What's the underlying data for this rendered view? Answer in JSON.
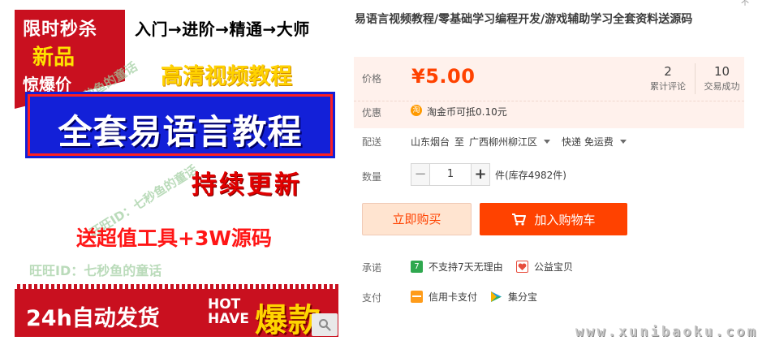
{
  "image": {
    "corner": [
      "限时秒杀",
      "新品",
      "惊爆价"
    ],
    "path": "入门→进阶→精通→大师",
    "hd": "高清视频教程",
    "headline": "全套易语言教程",
    "update": "持续更新",
    "gift": "送超值工具+3W源码",
    "watermark_rot": "旺旺ID：七秒鱼的童话",
    "watermark_small": "旺旺ID：七秒鱼的童话",
    "watermark_bottom": "旺旺ID：七秒鱼的童话",
    "bottom_text": "24h自动发货",
    "hot": "HOT",
    "have": "HAVE",
    "baokuan": "爆款"
  },
  "product": {
    "title": "易语言视频教程/零基础学习编程开发/游戏辅助学习全套资料送源码",
    "price_label": "价格",
    "price": "¥5.00",
    "reviews_count": "2",
    "reviews_label": "累计评论",
    "deals_count": "10",
    "deals_label": "交易成功",
    "promo_label": "优惠",
    "promo_icon": "淘",
    "promo_text": "淘金币可抵0.10元",
    "ship_label": "配送",
    "ship_from": "山东烟台",
    "ship_to_word": "至",
    "ship_dest": "广西柳州柳江区",
    "ship_method": "快递 免运费",
    "qty_label": "数量",
    "qty_minus": "−",
    "qty_value": "1",
    "qty_plus": "+",
    "stock": "件(库存4982件)",
    "buy_now": "立即购买",
    "add_cart": "加入购物车",
    "promise_label": "承诺",
    "promise_1_icon": "7",
    "promise_1": "不支持7天无理由",
    "promise_2": "公益宝贝",
    "pay_label": "支付",
    "pay_1": "信用卡支付",
    "pay_2": "集分宝"
  },
  "site_watermark": "www.xunibaoku.com",
  "top_fragment": "不",
  "colors": {
    "accent": "#ff4200",
    "price_bg": "#fff1ec",
    "banner_red": "#c9101f",
    "banner_blue": "#1320d8"
  }
}
